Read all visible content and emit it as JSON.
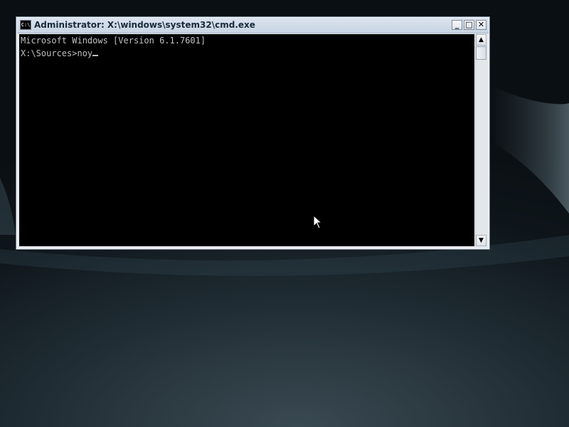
{
  "window": {
    "title": "Administrator: X:\\windows\\system32\\cmd.exe",
    "icon_label": "C:\\",
    "controls": {
      "minimize": "_",
      "maximize": "□",
      "close": "✕"
    }
  },
  "console": {
    "lines": [
      "Microsoft Windows [Version 6.1.7601]",
      "",
      "X:\\Sources>noy"
    ]
  },
  "scrollbar": {
    "up": "▲",
    "down": "▼"
  }
}
